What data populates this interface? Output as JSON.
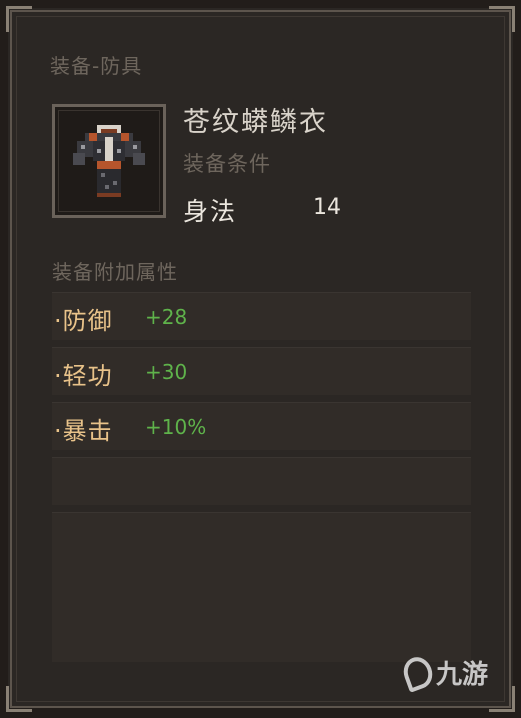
{
  "tooltip": {
    "category": "装备-防具",
    "item_name": "苍纹蟒鳞衣",
    "requirement_title": "装备条件",
    "requirement": {
      "stat": "身法",
      "value": "14"
    },
    "bonus_title": "装备附加属性",
    "bonuses": [
      {
        "label": "·防御",
        "value": "+28"
      },
      {
        "label": "·轻功",
        "value": "+30"
      },
      {
        "label": "·暴击",
        "value": "+10%"
      }
    ]
  },
  "icon": "armor-icon",
  "colors": {
    "background": "#2b2724",
    "muted_text": "#6e665d",
    "title_text": "#d9d3ca",
    "bonus_label": "#e9c38a",
    "bonus_value": "#5fb34b"
  },
  "watermark": {
    "text": "九游"
  }
}
